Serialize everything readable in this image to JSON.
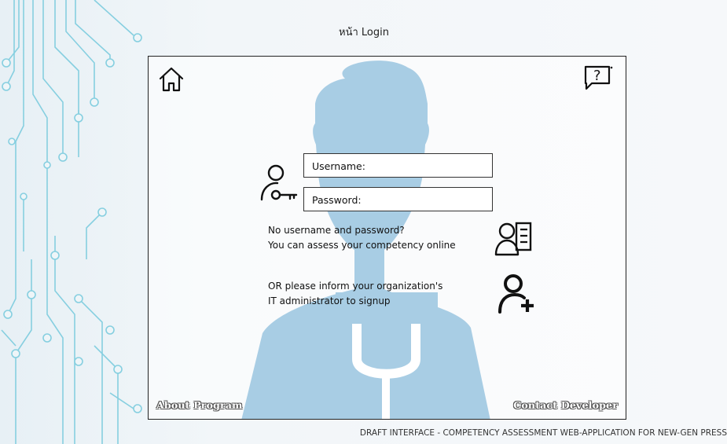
{
  "page": {
    "title": "หน้า Login"
  },
  "toolbar": {
    "home_icon": "home-icon",
    "help_icon": "help-speech-bubble-icon"
  },
  "login": {
    "username_placeholder": "Username:",
    "password_placeholder": "Password:",
    "user_icon": "user-key-icon"
  },
  "info": {
    "assess_line1": "No username and password?",
    "assess_line2": "You can assess your competency online",
    "assess_icon": "user-profile-card-icon",
    "admin_line1": "OR please inform your organization's",
    "admin_line2": "IT administrator to signup",
    "admin_icon": "add-user-icon"
  },
  "links": {
    "about": "About Program",
    "contact": "Contact Developer"
  },
  "footer": {
    "text": "DRAFT INTERFACE - COMPETENCY ASSESSMENT WEB-APPLICATION FOR NEW-GEN PRESS"
  },
  "colors": {
    "silhouette": "#a8cde4",
    "circuit": "#7ec8dc",
    "frame_border": "#222222"
  }
}
